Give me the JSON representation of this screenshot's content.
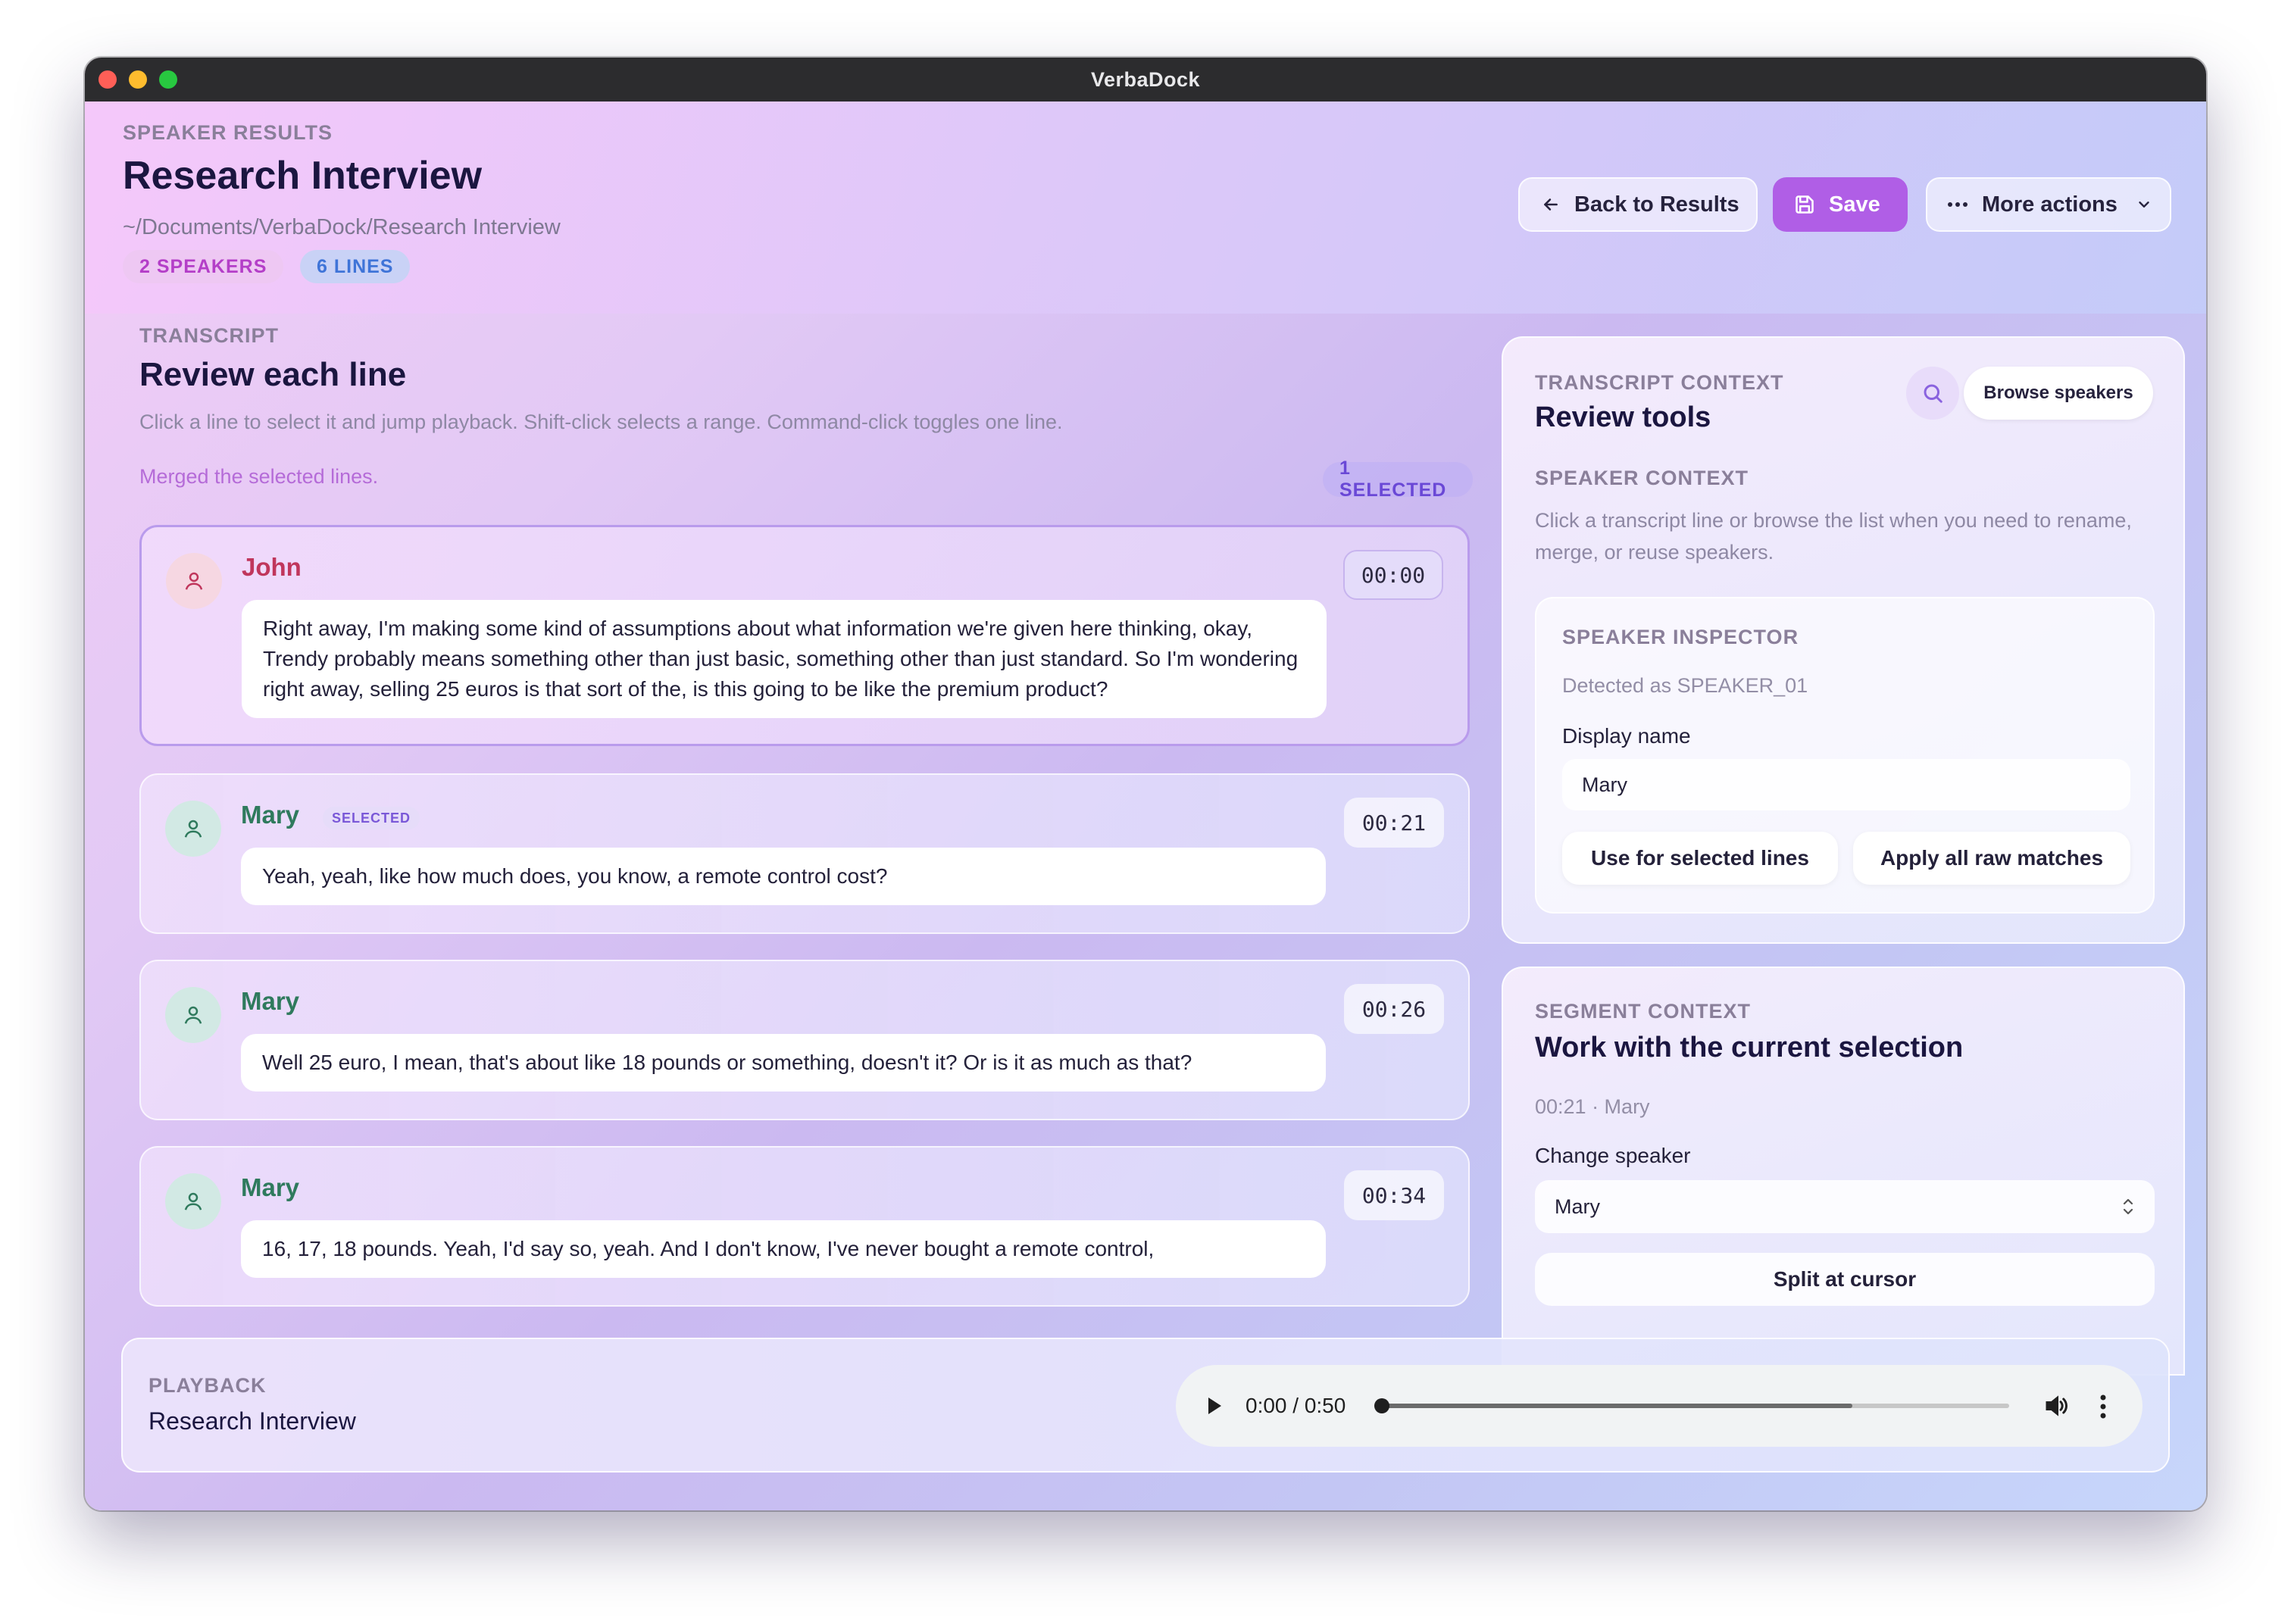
{
  "window": {
    "title": "VerbaDock"
  },
  "header": {
    "kicker": "SPEAKER RESULTS",
    "title": "Research Interview",
    "path": "~/Documents/VerbaDock/Research Interview",
    "badges": {
      "speakers": "2 SPEAKERS",
      "lines": "6 LINES"
    },
    "buttons": {
      "back": "Back to Results",
      "save": "Save",
      "more": "More actions"
    },
    "colors": {
      "save": "#b05ee6"
    }
  },
  "transcript": {
    "kicker": "TRANSCRIPT",
    "title": "Review each line",
    "help": "Click a line to select it and jump playback. Shift-click selects a range. Command-click toggles one line.",
    "status": "Merged the selected lines.",
    "selected_count": "1 SELECTED",
    "lines": [
      {
        "speaker": "John",
        "time": "00:00",
        "text": "Right away, I'm making some kind of assumptions about what information we're given here thinking, okay, Trendy probably means something other than just basic, something other than just standard. So I'm wondering right away, selling 25 euros is that sort of the, is this going to be like the premium product?"
      },
      {
        "speaker": "Mary",
        "tag": "SELECTED",
        "time": "00:21",
        "text": "Yeah, yeah, like how much does, you know, a remote control cost?"
      },
      {
        "speaker": "Mary",
        "time": "00:26",
        "text": "Well 25 euro, I mean, that's about like 18 pounds or something, doesn't it? Or is it as much as that?"
      },
      {
        "speaker": "Mary",
        "time": "00:34",
        "text": "16, 17, 18 pounds. Yeah, I'd say so, yeah. And I don't know, I've never bought a remote control,"
      }
    ]
  },
  "context": {
    "kicker": "TRANSCRIPT CONTEXT",
    "title": "Review tools",
    "browse": "Browse speakers",
    "speaker_context": "SPEAKER CONTEXT",
    "help": "Click a transcript line or browse the list when you need to rename, merge, or reuse speakers.",
    "inspector": {
      "kicker": "SPEAKER INSPECTOR",
      "detected": "Detected as SPEAKER_01",
      "label": "Display name",
      "value": "Mary",
      "use_btn": "Use for selected lines",
      "apply_btn": "Apply all raw matches"
    }
  },
  "segment": {
    "kicker": "SEGMENT CONTEXT",
    "title": "Work with the current selection",
    "meta": "00:21 · Mary",
    "change_label": "Change speaker",
    "change_value": "Mary",
    "split": "Split at cursor"
  },
  "playback": {
    "kicker": "PLAYBACK",
    "title": "Research Interview",
    "time": "0:00 / 0:50",
    "position": 0,
    "buffered": 0.75
  }
}
